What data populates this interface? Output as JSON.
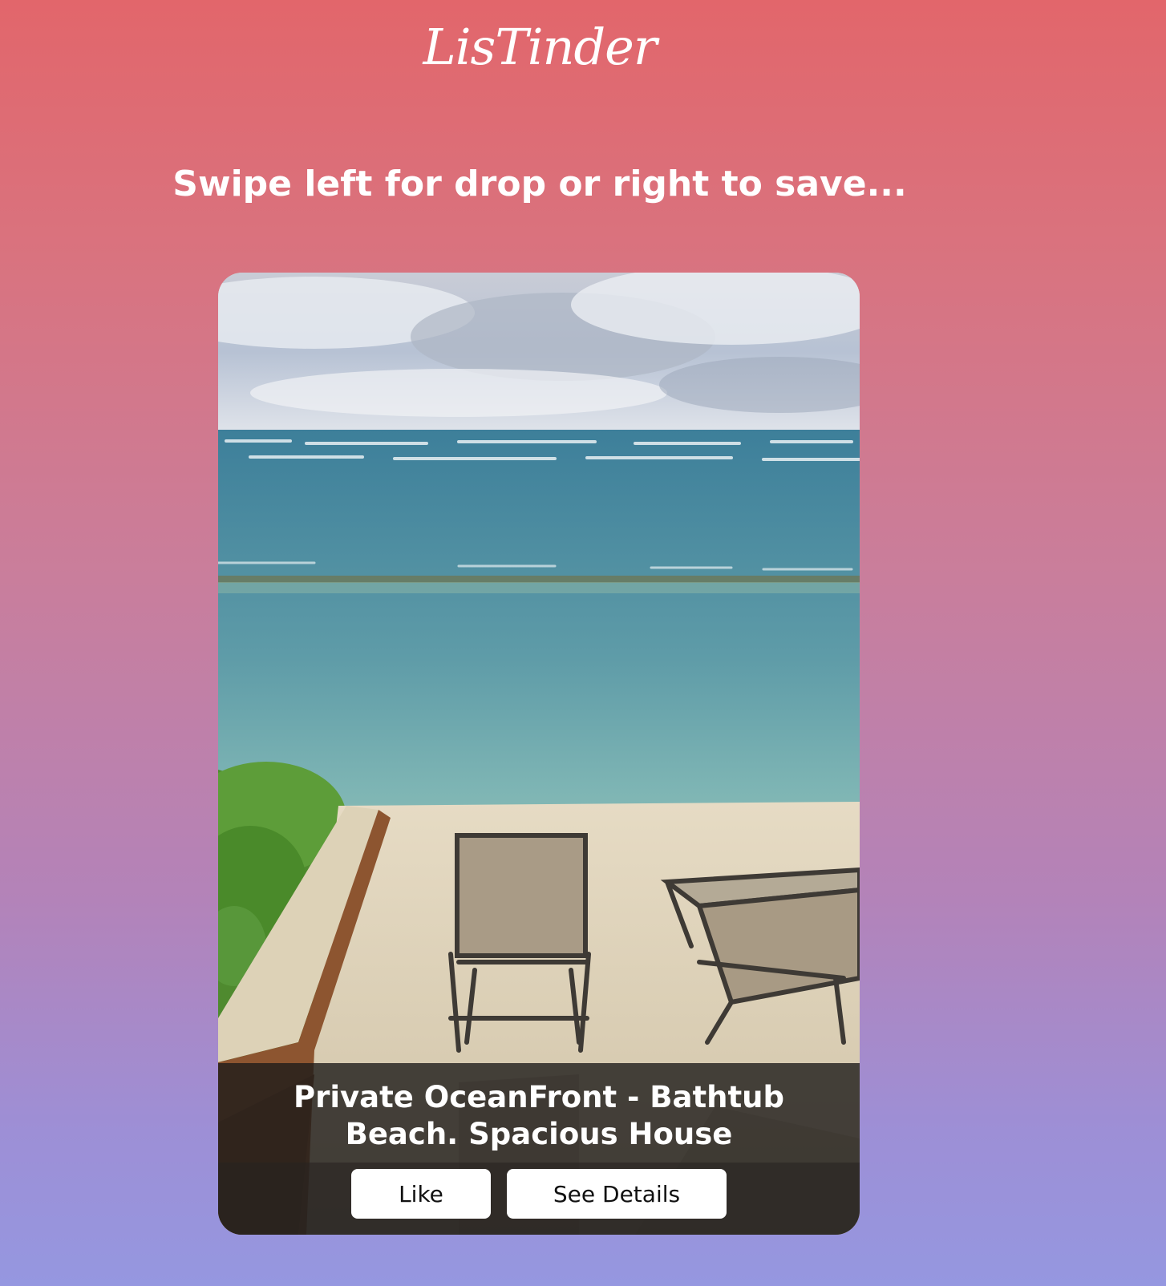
{
  "app": {
    "logo_text": "LisTinder"
  },
  "instructions": {
    "text": "Swipe left for drop or right to save..."
  },
  "listing_card": {
    "title": "Private OceanFront - Bathtub Beach. Spacious House",
    "photo_icon": "beach-photo",
    "like_label": "Like",
    "details_label": "See Details"
  },
  "colors": {
    "gradient_top": "#e2666b",
    "gradient_bottom": "#9597e0",
    "text": "#ffffff",
    "button_bg": "#ffffff"
  }
}
